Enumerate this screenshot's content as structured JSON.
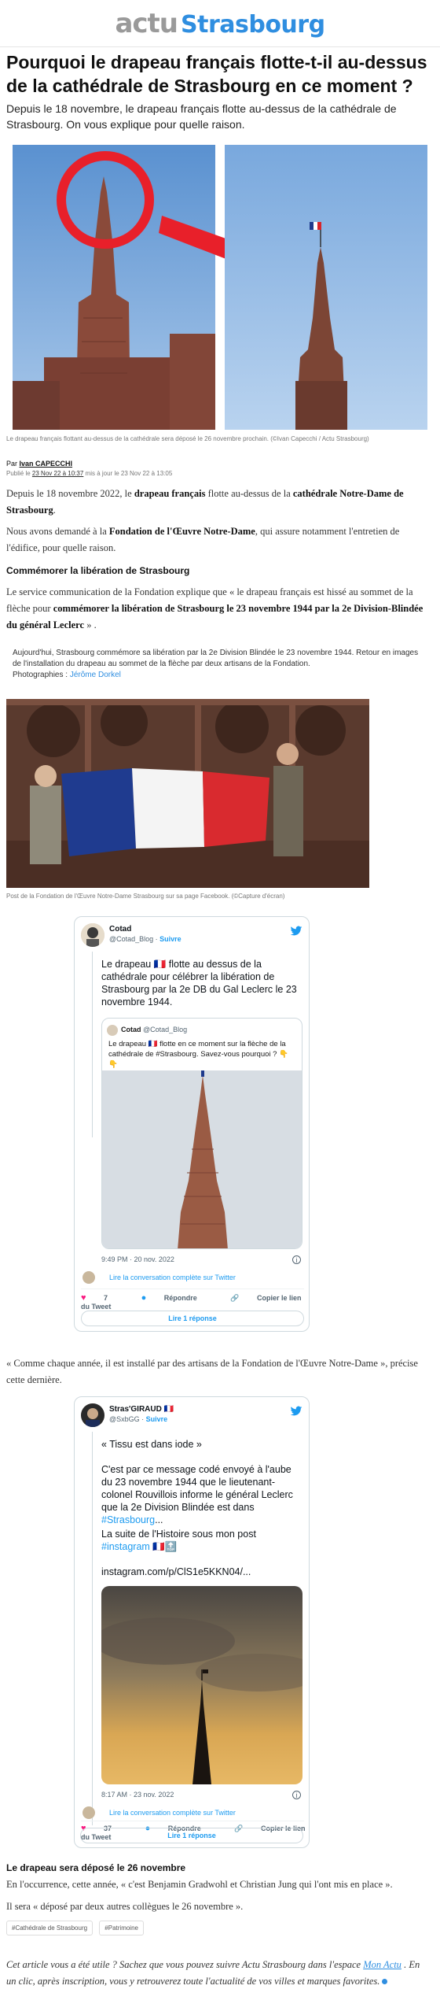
{
  "header": {
    "logo_actu": "actu",
    "logo_city": "Strasbourg"
  },
  "article": {
    "title": "Pourquoi le drapeau français flotte-t-il au-dessus de la cathédrale de Strasbourg en ce moment ?",
    "chapo": "Depuis le 18 novembre, le drapeau français flotte au-dessus de la cathédrale de Strasbourg. On vous explique pour quelle raison.",
    "hero_caption": "Le drapeau français flottant au-dessus de la cathédrale sera déposé le 26 novembre prochain. (©Ivan Capecchi / Actu Strasbourg)",
    "by_prefix": "Par",
    "author": "Ivan CAPECCHI",
    "published_prefix": "Publié le",
    "published": "23 Nov 22 à 10:37",
    "updated": "mis à jour le 23 Nov 22 à 13:05",
    "p1_a": "Depuis le 18 novembre 2022, le",
    "p1_b": "drapeau français",
    "p1_c": "flotte au-dessus de la",
    "p1_d": "cathédrale Notre-Dame de Strasbourg",
    "p2_a": "Nous avons demandé à la",
    "p2_b": "Fondation de l'Œuvre Notre-Dame",
    "p2_c": ", qui assure notamment l'entretien de l'édifice, pour quelle raison.",
    "h_commemorer": "Commémorer la libération de Strasbourg",
    "p3_a": "Le service communication de la Fondation explique que « le drapeau français est hissé au sommet de la flèche pour",
    "p3_b": "commémorer la libération de Strasbourg le 23 novembre 1944 par la 2e Division-Blindée du général Leclerc",
    "p3_c": "» .",
    "embed_text": "Aujourd'hui, Strasbourg commémore sa libération par la 2e Division Blindée le 23 novembre 1944. Retour en images de l'installation du drapeau au sommet de la flèche par deux artisans de la Fondation.",
    "embed_photo_prefix": "Photographies :",
    "embed_photo_author": "Jérôme Dorkel",
    "photo2_caption": "Post de la Fondation de l'Œuvre Notre-Dame Strasbourg sur sa page Facebook. (©Capture d'écran)",
    "p4": "« Comme chaque année, il est installé par des artisans de la Fondation de l'Œuvre Notre-Dame », précise cette dernière.",
    "h_depose": "Le drapeau sera déposé le 26 novembre",
    "p5": "En l'occurrence, cette année, « c'est Benjamin Gradwohl et Christian Jung qui l'ont mis en place ».",
    "p6": "Il sera « déposé par deux autres collègues le 26 novembre ».",
    "tags": [
      "#Cathédrale de Strasbourg",
      "#Patrimoine"
    ],
    "promo_a": "Cet article vous a été utile ? Sachez que vous pouvez suivre Actu Strasbourg dans l'espace",
    "promo_link": "Mon Actu",
    "promo_b": ". En un clic, après inscription, vous y retrouverez toute l'actualité de vos villes et marques favorites."
  },
  "tweet1": {
    "name": "Cotad",
    "handle": "@Cotad_Blog",
    "follow": "Suivre",
    "text": "Le drapeau 🇫🇷 flotte au dessus de la cathédrale pour célébrer la libération de Strasbourg par la 2e DB du Gal Leclerc le 23 novembre 1944.",
    "quote_name": "Cotad",
    "quote_handle": "@Cotad_Blog",
    "quote_text": "Le drapeau 🇫🇷 flotte en ce moment sur la flèche de la cathédrale de #Strasbourg. Savez-vous pourquoi ? 👇👇",
    "time": "9:49 PM · 20 nov. 2022",
    "conversation": "Lire la conversation complète sur Twitter",
    "likes": "7",
    "reply_label": "Répondre",
    "copy_label": "Copier le lien du Tweet",
    "replies": "Lire 1 réponse"
  },
  "tweet2": {
    "name": "Stras'GIRAUD 🇫🇷",
    "handle": "@SxbGG",
    "follow": "Suivre",
    "line1": "« Tissu est dans iode »",
    "line2": "C'est par ce message codé envoyé à l'aube du 23 novembre 1944 que le lieutenant-colonel Rouvillois informe le général Leclerc que la 2e Division Blindée est dans",
    "line2_tag": "#Strasbourg",
    "line2_end": "...",
    "line3": "La suite de l'Histoire sous mon post",
    "line3_tag": "#instagram",
    "line3_flags": "🇫🇷🔝",
    "link": "instagram.com/p/ClS1e5KKN04/...",
    "time": "8:17 AM · 23 nov. 2022",
    "conversation": "Lire la conversation complète sur Twitter",
    "likes": "37",
    "reply_label": "Répondre",
    "copy_label": "Copier le lien du Tweet",
    "replies": "Lire 1 réponse"
  },
  "colors": {
    "brand_blue": "#2f8ee0",
    "twitter_blue": "#1d9bf0",
    "highlight_red": "#e8202a"
  }
}
